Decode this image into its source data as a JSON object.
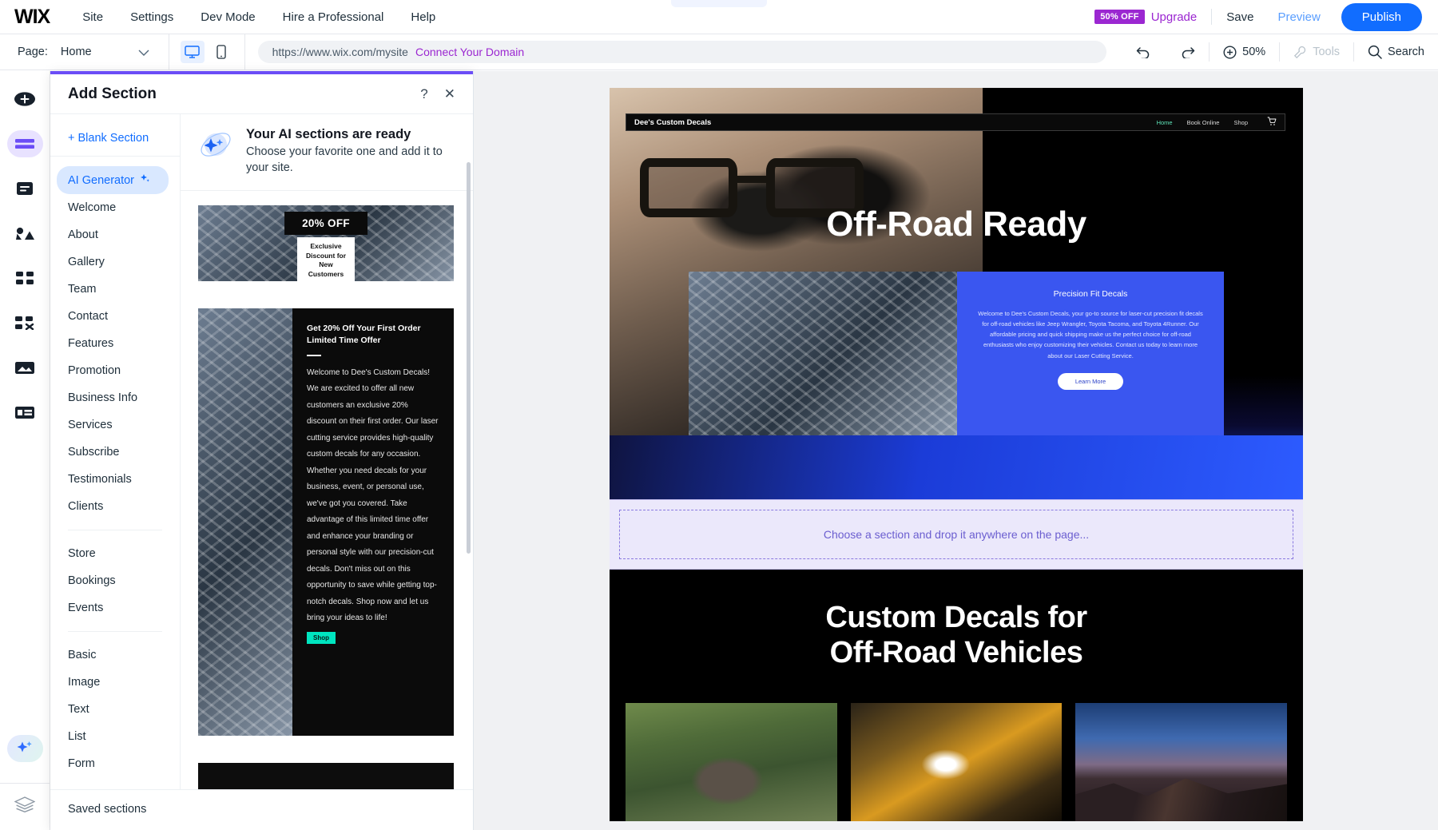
{
  "topbar": {
    "logo": "WIX",
    "menu": [
      "Site",
      "Settings",
      "Dev Mode",
      "Hire a Professional",
      "Help"
    ],
    "discount_badge": "50% OFF",
    "upgrade": "Upgrade",
    "save": "Save",
    "preview": "Preview",
    "publish": "Publish"
  },
  "secondbar": {
    "page_label": "Page:",
    "page_name": "Home",
    "url": "https://www.wix.com/mysite",
    "connect_domain": "Connect Your Domain",
    "zoom": "50%",
    "tools": "Tools",
    "search": "Search"
  },
  "rail": {
    "items": [
      {
        "name": "add-elements-icon",
        "label": "Add Elements"
      },
      {
        "name": "add-section-icon",
        "label": "Add Section"
      },
      {
        "name": "pages-icon",
        "label": "Pages"
      },
      {
        "name": "site-design-icon",
        "label": "Site Design"
      },
      {
        "name": "apps-icon",
        "label": "Apps"
      },
      {
        "name": "my-business-icon",
        "label": "My Business"
      },
      {
        "name": "media-icon",
        "label": "Media"
      },
      {
        "name": "cms-icon",
        "label": "CMS"
      }
    ],
    "ai_assistant": "AI Assistant",
    "layers": "Layers"
  },
  "panel": {
    "title": "Add Section",
    "help_icon": "?",
    "close_icon": "✕",
    "blank_section": "+ Blank Section",
    "categories_group1": [
      "AI Generator",
      "Welcome",
      "About",
      "Gallery",
      "Team",
      "Contact",
      "Features",
      "Promotion",
      "Business Info",
      "Services",
      "Subscribe",
      "Testimonials",
      "Clients"
    ],
    "active_category": "AI Generator",
    "categories_group2": [
      "Store",
      "Bookings",
      "Events"
    ],
    "categories_group3": [
      "Basic",
      "Image",
      "Text",
      "List",
      "Form"
    ],
    "saved_sections": "Saved sections",
    "ai_banner": {
      "title": "Your AI sections are ready",
      "body": "Choose your favorite one and add it to your site."
    },
    "card1": {
      "headline": "20% OFF",
      "sub": "Exclusive Discount for New Customers"
    },
    "card2": {
      "heading_line1": "Get 20% Off Your First Order",
      "heading_line2": "Limited Time Offer",
      "body": "Welcome to Dee's Custom Decals! We are excited to offer all new customers an exclusive 20% discount on their first order. Our laser cutting service provides high-quality custom decals for any occasion. Whether you need decals for your business, event, or personal use, we've got you covered. Take advantage of this limited time offer and enhance your branding or personal style with our precision-cut decals. Don't miss out on this opportunity to save while getting top-notch decals. Shop now and let us bring your ideas to life!",
      "button": "Shop"
    }
  },
  "site": {
    "brand": "Dee's Custom Decals",
    "nav": [
      "Home",
      "Book Online",
      "Shop"
    ],
    "nav_active": "Home",
    "cart_icon": "cart-icon",
    "hero_title": "Off-Road Ready",
    "promo_card": {
      "title": "Precision Fit Decals",
      "body": "Welcome to Dee's Custom Decals, your go-to source for laser-cut precision fit decals for off-road vehicles like Jeep Wrangler, Toyota Tacoma, and Toyota 4Runner. Our affordable pricing and quick shipping make us the perfect choice for off-road enthusiasts who enjoy customizing their vehicles. Contact us today to learn more about our Laser Cutting Service.",
      "button": "Learn More"
    },
    "dropzone": "Choose a section and drop it anywhere on the page...",
    "lower_title_line1": "Custom Decals for",
    "lower_title_line2": "Off-Road Vehicles"
  },
  "colors": {
    "accent_blue": "#116dff",
    "purple": "#9b27d1",
    "panel_accent": "#6b4df6",
    "dropzone_purple": "#6b5ed0",
    "site_blue": "#3a56f0"
  }
}
